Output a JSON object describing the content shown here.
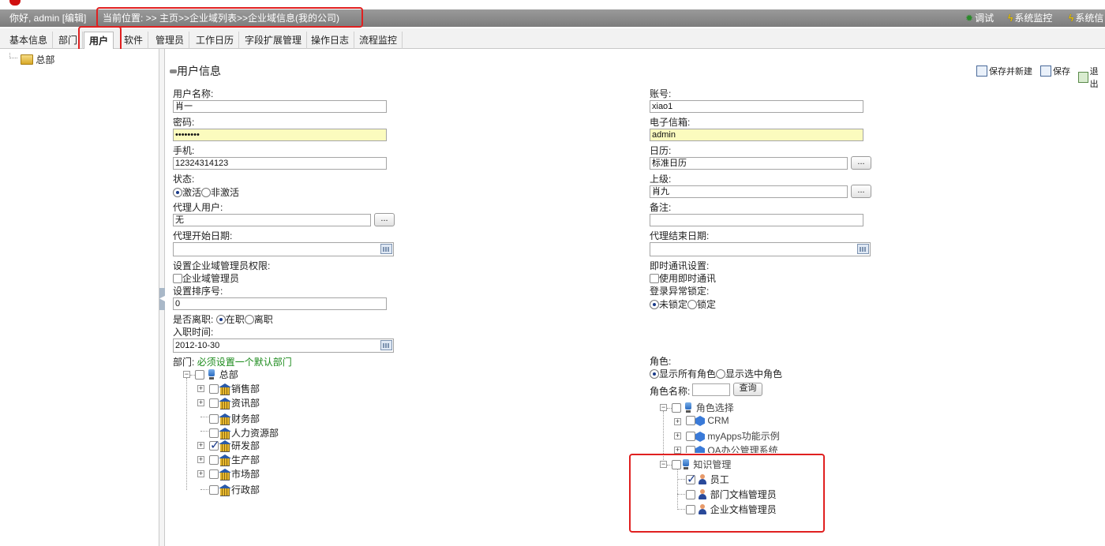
{
  "header": {
    "greeting": "你好, admin",
    "edit_link": "[编辑]",
    "breadcrumb": "当前位置: >> 主页>>企业域列表>>企业域信息(我的公司)",
    "right_items": [
      {
        "icon": "bug-icon",
        "label": "调试"
      },
      {
        "icon": "lightning-icon",
        "label": "系统监控"
      },
      {
        "icon": "lightning-icon",
        "label": "系统信"
      }
    ]
  },
  "tabs": [
    "基本信息",
    "部门",
    "用户",
    "软件",
    "管理员",
    "工作日历",
    "字段扩展管理",
    "操作日志",
    "流程监控"
  ],
  "active_tab": "用户",
  "left_tree": {
    "root_label": "总部"
  },
  "panel": {
    "title": "用户信息",
    "toolbar": {
      "save_new": "保存并新建",
      "save": "保存",
      "exit": "退出"
    }
  },
  "form": {
    "username_label": "用户名称:",
    "username_value": "肖一",
    "account_label": "账号:",
    "account_value": "xiao1",
    "password_label": "密码:",
    "password_value": "••••••••",
    "email_label": "电子信箱:",
    "email_value": "admin",
    "phone_label": "手机:",
    "phone_value": "12324314123",
    "calendar_label": "日历:",
    "calendar_value": "标准日历",
    "status_label": "状态:",
    "status_active": "激活",
    "status_inactive": "非激活",
    "superior_label": "上级:",
    "superior_value": "肖九",
    "proxy_label": "代理人用户:",
    "proxy_value": "无",
    "remark_label": "备注:",
    "remark_value": "",
    "proxy_start_label": "代理开始日期:",
    "proxy_start_value": "",
    "proxy_end_label": "代理结束日期:",
    "proxy_end_value": "",
    "admin_perm_label": "设置企业域管理员权限:",
    "admin_perm_checkbox": "企业域管理员",
    "im_label": "即时通讯设置:",
    "im_checkbox": "使用即时通讯",
    "sort_label": "设置排序号:",
    "sort_value": "0",
    "lock_label": "登录异常锁定:",
    "lock_unlocked": "未锁定",
    "lock_locked": "锁定",
    "resign_label": "是否离职:",
    "resign_on": "在职",
    "resign_off": "离职",
    "hire_label": "入职时间:",
    "hire_value": "2012-10-30",
    "dept_label": "部门:",
    "dept_hint": "必须设置一个默认部门",
    "dept_hint_color": "#1a8a1a",
    "dept_root": "总部",
    "departments": [
      {
        "label": "销售部",
        "checked": false
      },
      {
        "label": "资讯部",
        "checked": false
      },
      {
        "label": "财务部",
        "checked": false
      },
      {
        "label": "人力资源部",
        "checked": false
      },
      {
        "label": "研发部",
        "checked": true
      },
      {
        "label": "生产部",
        "checked": false
      },
      {
        "label": "市场部",
        "checked": false
      },
      {
        "label": "行政部",
        "checked": false
      }
    ],
    "role_label": "角色:",
    "role_show_all": "显示所有角色",
    "role_show_selected": "显示选中角色",
    "role_name_label": "角色名称:",
    "role_name_value": "",
    "role_query": "查询",
    "dots": "...",
    "role_root": "角色选择",
    "role_groups": [
      "CRM",
      "myApps功能示例",
      "OA办公管理系统"
    ],
    "km_group": "知识管理",
    "km_roles": [
      {
        "label": "员工",
        "checked": true
      },
      {
        "label": "部门文档管理员",
        "checked": false
      },
      {
        "label": "企业文档管理员",
        "checked": false
      }
    ]
  }
}
